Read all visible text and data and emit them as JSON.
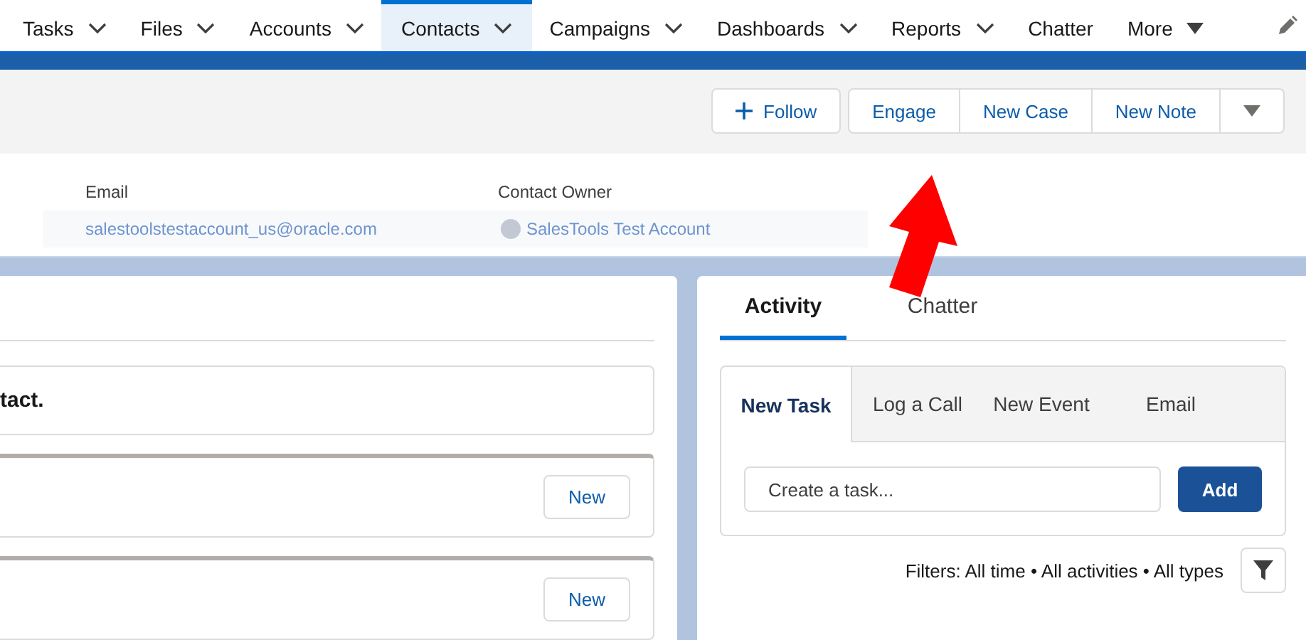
{
  "nav": {
    "items": [
      {
        "label": "Tasks",
        "kind": "menu",
        "selected": false
      },
      {
        "label": "Files",
        "kind": "menu",
        "selected": false
      },
      {
        "label": "Accounts",
        "kind": "menu",
        "selected": false
      },
      {
        "label": "Contacts",
        "kind": "menu",
        "selected": true
      },
      {
        "label": "Campaigns",
        "kind": "menu",
        "selected": false
      },
      {
        "label": "Dashboards",
        "kind": "menu",
        "selected": false
      },
      {
        "label": "Reports",
        "kind": "menu",
        "selected": false
      },
      {
        "label": "Chatter",
        "kind": "link",
        "selected": false
      },
      {
        "label": "More",
        "kind": "more",
        "selected": false
      }
    ]
  },
  "header": {
    "follow": "Follow",
    "actions": [
      "Engage",
      "New Case",
      "New Note"
    ]
  },
  "highlights": [
    {
      "label": "Email",
      "value": "salestoolstestaccount_us@oracle.com",
      "kind": "email"
    },
    {
      "label": "Contact Owner",
      "value": "SalesTools Test Account",
      "kind": "owner"
    }
  ],
  "details": {
    "message": "tact.",
    "related": [
      {
        "button": "New"
      },
      {
        "button": "New"
      }
    ]
  },
  "activity": {
    "tabs": [
      {
        "label": "Activity",
        "selected": true
      },
      {
        "label": "Chatter",
        "selected": false
      }
    ],
    "composer_tabs": [
      {
        "label": "New Task",
        "selected": true
      },
      {
        "label": "Log a Call",
        "selected": false
      },
      {
        "label": "New Event",
        "selected": false
      },
      {
        "label": "Email",
        "selected": false
      }
    ],
    "task_placeholder": "Create a task...",
    "add": "Add",
    "filters": "Filters: All time • All activities • All types"
  }
}
